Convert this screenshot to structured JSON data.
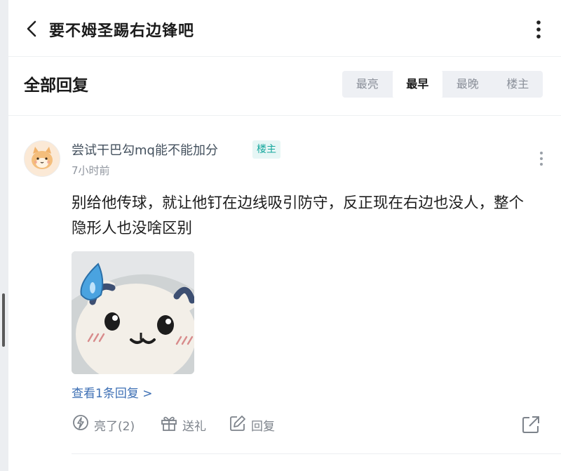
{
  "header": {
    "title": "要不姆圣踢右边锋吧"
  },
  "subhead": {
    "title": "全部回复",
    "sort_options": [
      "最亮",
      "最早",
      "最晚",
      "楼主"
    ],
    "active_sort": "最早"
  },
  "post": {
    "user_name": "尝试干巴勾mq能不能加分",
    "badge": "楼主",
    "time": "7小时前",
    "content": "别给他传球，就让他钉在边线吸引防守，反正现在右边也没人，整个隐形人也没啥区别",
    "view_replies": "查看1条回复 >",
    "actions": {
      "like": "亮了(2)",
      "gift": "送礼",
      "reply": "回复"
    }
  },
  "colors": {
    "accent_teal": "#15a79d",
    "link_blue": "#3d6fb4",
    "muted_gray": "#8f959e"
  },
  "icons": [
    "back-icon",
    "more-vertical-icon",
    "more-horizontal-icon",
    "lightning-icon",
    "gift-icon",
    "edit-icon",
    "share-icon"
  ]
}
